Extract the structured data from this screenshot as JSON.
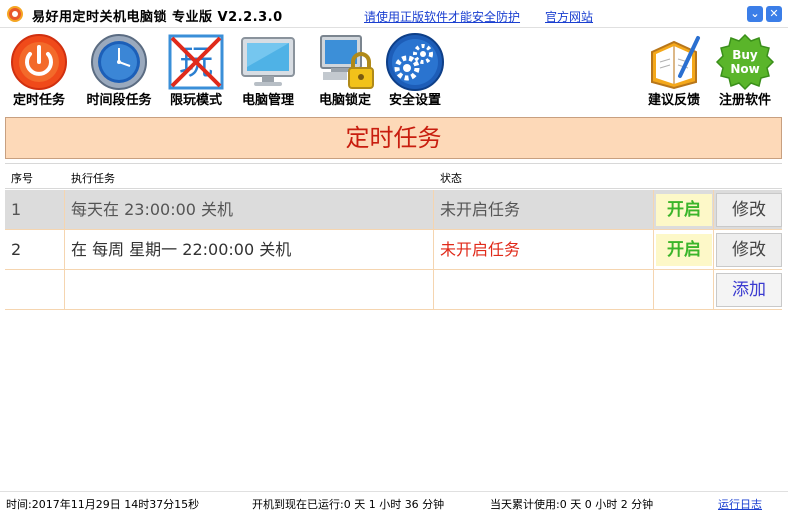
{
  "titlebar": {
    "title": "易好用定时关机电脑锁 专业版 V2.2.3.0",
    "link_genuine": "请使用正版软件才能安全防护",
    "link_site": "官方网站",
    "min_glyph": "⌄",
    "close_glyph": "✕"
  },
  "toolbar": {
    "items": [
      {
        "label": "定时任务",
        "icon": "power-icon"
      },
      {
        "label": "时间段任务",
        "icon": "clock-icon"
      },
      {
        "label": "限玩模式",
        "icon": "no-play-icon"
      },
      {
        "label": "电脑管理",
        "icon": "monitor-icon"
      },
      {
        "label": "电脑锁定",
        "icon": "computer-lock-icon"
      },
      {
        "label": "安全设置",
        "icon": "gears-icon"
      },
      {
        "label": "建议反馈",
        "icon": "notebook-icon"
      },
      {
        "label": "注册软件",
        "icon": "buy-now-icon"
      }
    ],
    "buy_text_1": "Buy",
    "buy_text_2": "Now",
    "restricted_glyph": "玩"
  },
  "banner": {
    "title": "定时任务"
  },
  "table": {
    "headers": [
      "序号",
      "执行任务",
      "状态"
    ],
    "rows": [
      {
        "idx": "1",
        "task": "每天在 23:00:00 关机",
        "status": "未开启任务",
        "on_label": "开启",
        "edit_label": "修改",
        "status_color": "#555555"
      },
      {
        "idx": "2",
        "task": "在 每周 星期一 22:00:00 关机",
        "status": "未开启任务",
        "on_label": "开启",
        "edit_label": "修改",
        "status_color": "#e02a1a"
      }
    ],
    "add_label": "添加"
  },
  "statusbar": {
    "time": "时间:2017年11月29日 14时37分15秒",
    "uptime": "开机到现在已运行:0 天 1 小时 36 分钟",
    "today": "当天累计使用:0 天 0 小时 2 分钟",
    "log_link": "运行日志"
  }
}
